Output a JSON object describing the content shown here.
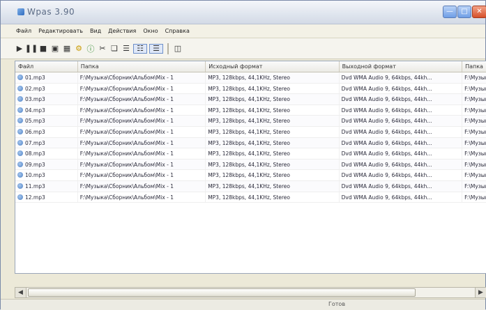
{
  "window": {
    "title": "Wpas 3.90"
  },
  "menu": [
    "Файл",
    "Редактировать",
    "Вид",
    "Действия",
    "Окно",
    "Справка"
  ],
  "toolbar": {
    "icons": [
      "play-icon",
      "pause-icon",
      "stop-icon",
      "add-file-icon",
      "add-folder-icon",
      "options-icon",
      "info-icon",
      "cut-icon",
      "copy-icon",
      "properties-icon",
      "list-view-icon",
      "details-view-icon",
      "sep",
      "panel-icon"
    ]
  },
  "table": {
    "columns": [
      "Файл",
      "Папка",
      "Исходный формат",
      "Выходной формат",
      "Папка"
    ],
    "rows": [
      [
        "01.mp3",
        "F:\\Музыка\\Сборник\\Альбом\\Mix - 1",
        "MP3, 128kbps, 44,1KHz, Stereo",
        "Dvd WMA Audio 9, 64kbps, 44kh...",
        "F:\\Музыка"
      ],
      [
        "02.mp3",
        "F:\\Музыка\\Сборник\\Альбом\\Mix - 1",
        "MP3, 128kbps, 44,1KHz, Stereo",
        "Dvd WMA Audio 9, 64kbps, 44kh...",
        "F:\\Музыка"
      ],
      [
        "03.mp3",
        "F:\\Музыка\\Сборник\\Альбом\\Mix - 1",
        "MP3, 128kbps, 44,1KHz, Stereo",
        "Dvd WMA Audio 9, 64kbps, 44kh...",
        "F:\\Музыка"
      ],
      [
        "04.mp3",
        "F:\\Музыка\\Сборник\\Альбом\\Mix - 1",
        "MP3, 128kbps, 44,1KHz, Stereo",
        "Dvd WMA Audio 9, 64kbps, 44kh...",
        "F:\\Музыка"
      ],
      [
        "05.mp3",
        "F:\\Музыка\\Сборник\\Альбом\\Mix - 1",
        "MP3, 128kbps, 44,1KHz, Stereo",
        "Dvd WMA Audio 9, 64kbps, 44kh...",
        "F:\\Музыка"
      ],
      [
        "06.mp3",
        "F:\\Музыка\\Сборник\\Альбом\\Mix - 1",
        "MP3, 128kbps, 44,1KHz, Stereo",
        "Dvd WMA Audio 9, 64kbps, 44kh...",
        "F:\\Музыка"
      ],
      [
        "07.mp3",
        "F:\\Музыка\\Сборник\\Альбом\\Mix - 1",
        "MP3, 128kbps, 44,1KHz, Stereo",
        "Dvd WMA Audio 9, 64kbps, 44kh...",
        "F:\\Музыка"
      ],
      [
        "08.mp3",
        "F:\\Музыка\\Сборник\\Альбом\\Mix - 1",
        "MP3, 128kbps, 44,1KHz, Stereo",
        "Dvd WMA Audio 9, 64kbps, 44kh...",
        "F:\\Музыка"
      ],
      [
        "09.mp3",
        "F:\\Музыка\\Сборник\\Альбом\\Mix - 1",
        "MP3, 128kbps, 44,1KHz, Stereo",
        "Dvd WMA Audio 9, 64kbps, 44kh...",
        "F:\\Музыка"
      ],
      [
        "10.mp3",
        "F:\\Музыка\\Сборник\\Альбом\\Mix - 1",
        "MP3, 128kbps, 44,1KHz, Stereo",
        "Dvd WMA Audio 9, 64kbps, 44kh...",
        "F:\\Музыка"
      ],
      [
        "11.mp3",
        "F:\\Музыка\\Сборник\\Альбом\\Mix - 1",
        "MP3, 128kbps, 44,1KHz, Stereo",
        "Dvd WMA Audio 9, 64kbps, 44kh...",
        "F:\\Музыка"
      ],
      [
        "12.mp3",
        "F:\\Музыка\\Сборник\\Альбом\\Mix - 1",
        "MP3, 128kbps, 44,1KHz, Stereo",
        "Dvd WMA Audio 9, 64kbps, 44kh...",
        "F:\\Музыка"
      ]
    ]
  },
  "status": {
    "text": "Готов"
  }
}
